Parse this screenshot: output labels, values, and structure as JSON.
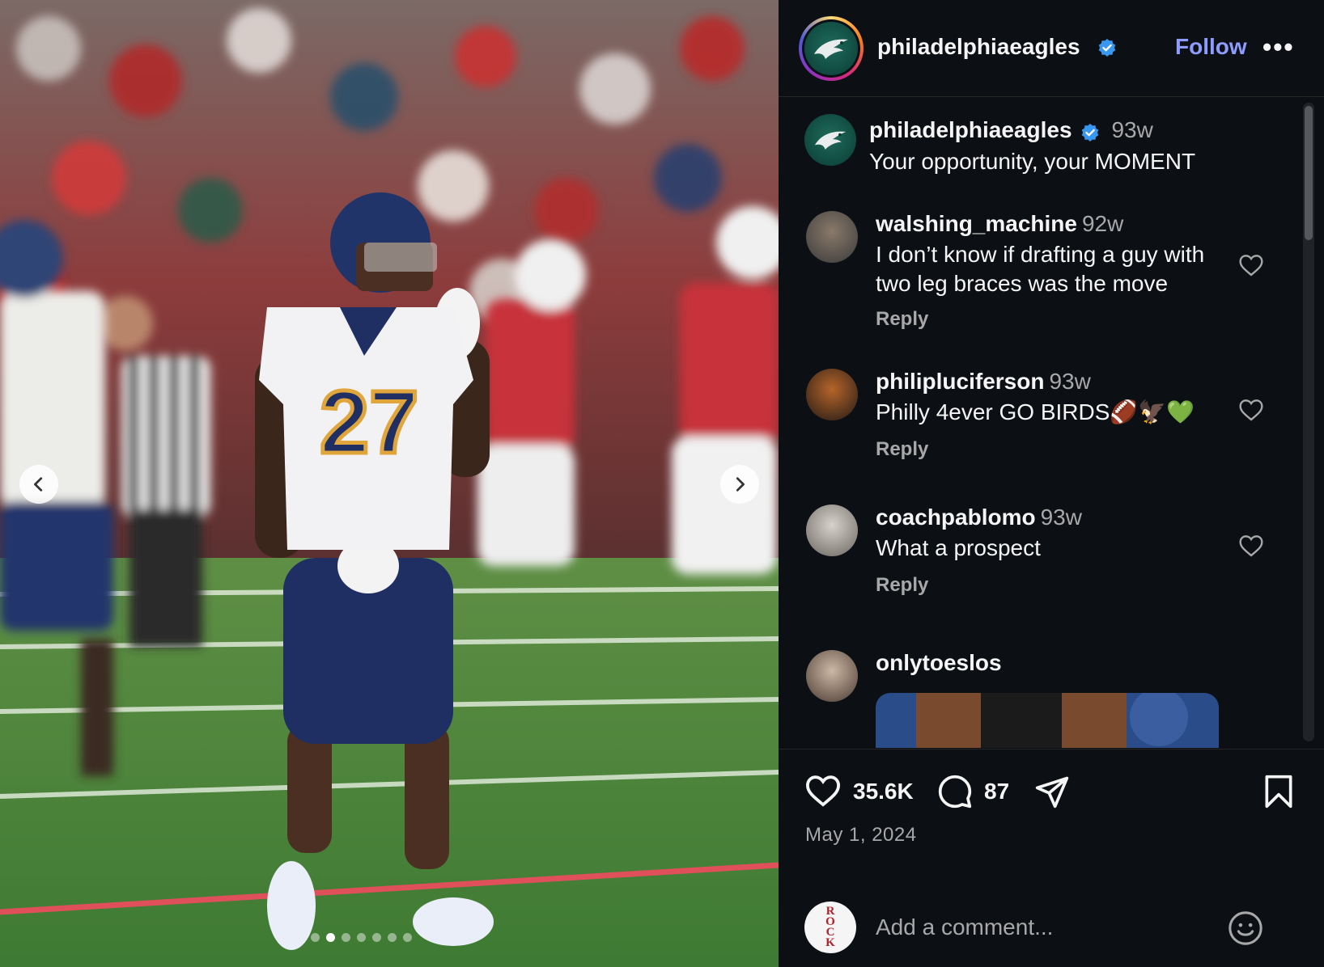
{
  "post": {
    "author": "philadelphiaeagles",
    "follow_label": "Follow",
    "more_label": "•••",
    "caption_time": "93w",
    "caption": "Your opportunity, your MOMENT"
  },
  "comments": [
    {
      "username": "walshing_machine",
      "time": "92w",
      "text": "I don’t know if drafting a guy with two leg braces was the move",
      "reply_label": "Reply"
    },
    {
      "username": "philipluciferson",
      "time": "93w",
      "text": "Philly 4ever GO BIRDS🏈🦅💚",
      "reply_label": "Reply"
    },
    {
      "username": "coachpablomo",
      "time": "93w",
      "text": "What a prospect",
      "reply_label": "Reply"
    },
    {
      "username": "onlytoeslos",
      "time": "",
      "text": "",
      "reply_label": ""
    }
  ],
  "stats": {
    "likes": "35.6K",
    "comments": "87",
    "date": "May 1, 2024"
  },
  "add_comment": {
    "placeholder": "Add a comment...",
    "avatar_text": "ROCK"
  },
  "carousel": {
    "total_images": 7,
    "active_index": 1
  },
  "colors": {
    "panel_bg": "#0c1014",
    "follow": "#8e9cff",
    "verified": "#3897f0",
    "muted": "#a8a8a8"
  },
  "icons": [
    "chevron-left-icon",
    "chevron-right-icon",
    "verified-badge-icon",
    "heart-icon",
    "comment-icon",
    "share-icon",
    "bookmark-icon",
    "emoji-icon"
  ]
}
